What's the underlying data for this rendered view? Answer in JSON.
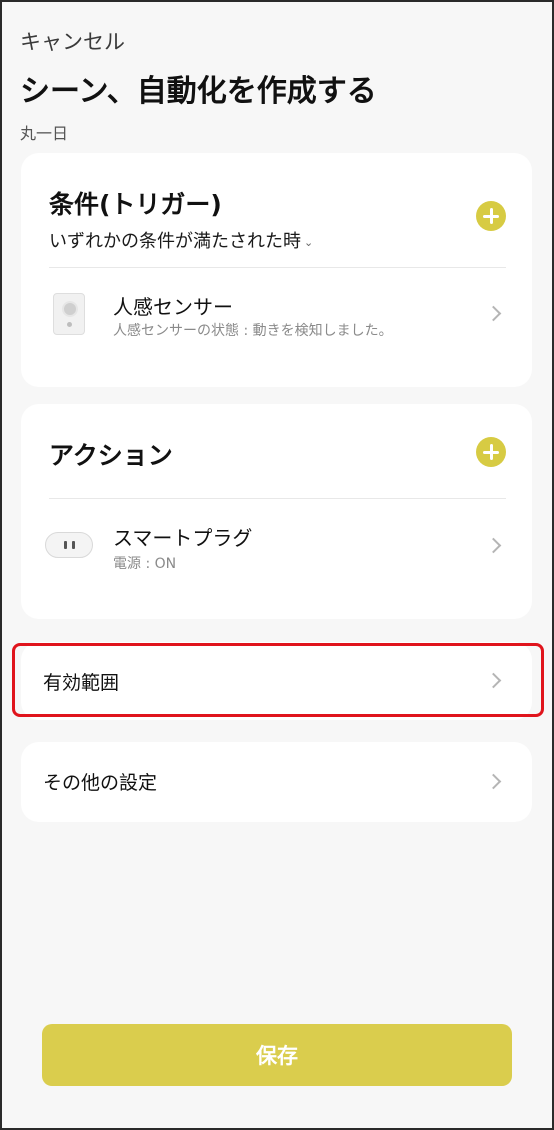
{
  "header": {
    "cancel_label": "キャンセル",
    "title": "シーン、自動化を作成する",
    "schedule": "丸一日"
  },
  "conditions": {
    "heading": "条件(トリガー)",
    "match_mode": "いずれかの条件が満たされた時",
    "items": [
      {
        "name": "人感センサー",
        "description": "人感センサーの状態 : 動きを検知しました。",
        "icon": "motion-sensor-icon"
      }
    ]
  },
  "actions": {
    "heading": "アクション",
    "items": [
      {
        "name": "スマートプラグ",
        "description": "電源 : ON",
        "icon": "smart-plug-icon"
      }
    ]
  },
  "effective_range": {
    "label": "有効範囲"
  },
  "other_settings": {
    "label": "その他の設定"
  },
  "footer": {
    "save_label": "保存"
  },
  "colors": {
    "accent": "#d7cb43",
    "save_button": "#dacd4d",
    "highlight_border": "#e0141c",
    "background": "#f7f7f7"
  }
}
